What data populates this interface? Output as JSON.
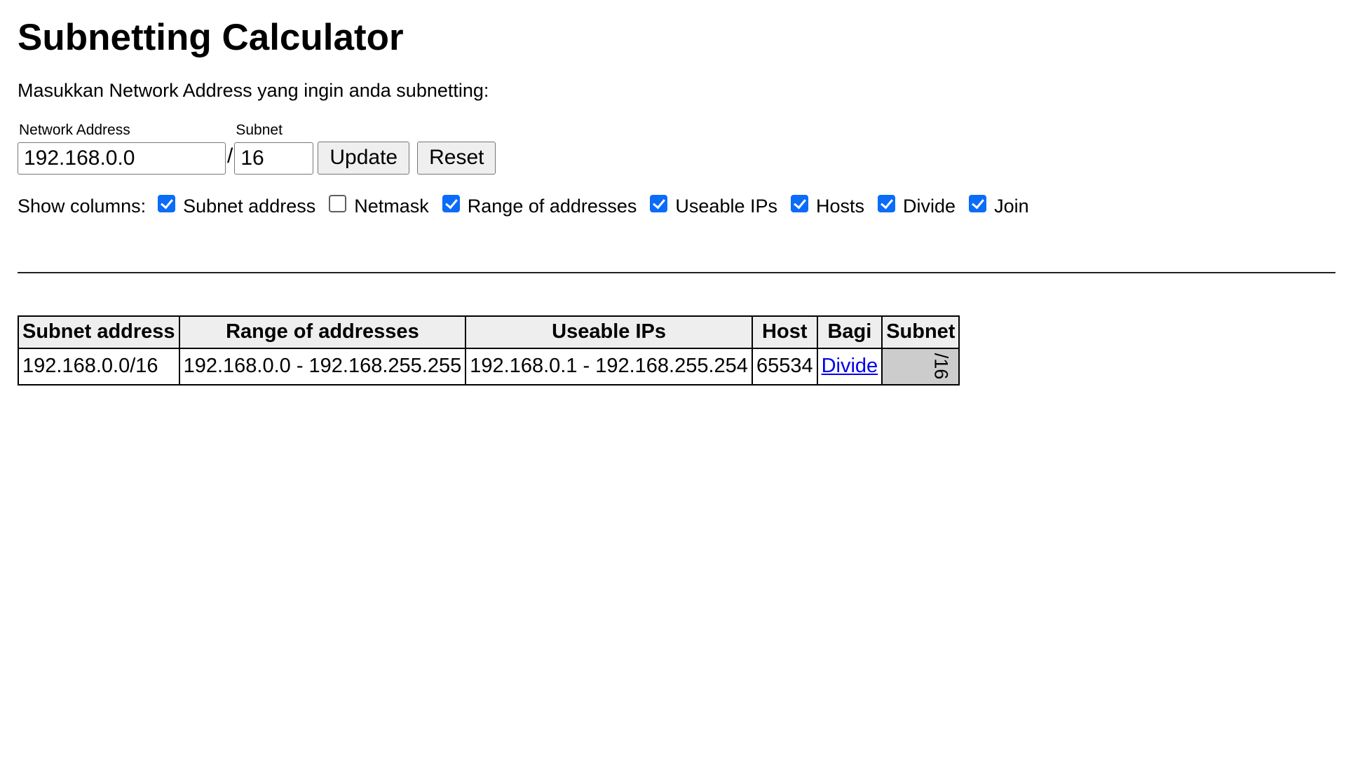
{
  "page": {
    "title": "Subnetting Calculator",
    "instruction": "Masukkan Network Address yang ingin anda subnetting:"
  },
  "form": {
    "network_label": "Network Address",
    "network_value": "192.168.0.0",
    "subnet_label": "Subnet",
    "separator": "/",
    "subnet_value": "16",
    "update_label": "Update",
    "reset_label": "Reset"
  },
  "columns": {
    "label": "Show columns:",
    "options": [
      {
        "label": "Subnet address",
        "checked": true
      },
      {
        "label": "Netmask",
        "checked": false
      },
      {
        "label": "Range of addresses",
        "checked": true
      },
      {
        "label": "Useable IPs",
        "checked": true
      },
      {
        "label": "Hosts",
        "checked": true
      },
      {
        "label": "Divide",
        "checked": true
      },
      {
        "label": "Join",
        "checked": true
      }
    ]
  },
  "table": {
    "headers": [
      "Subnet address",
      "Range of addresses",
      "Useable IPs",
      "Host",
      "Bagi",
      "Subnet"
    ],
    "rows": [
      {
        "subnet_address": "192.168.0.0/16",
        "range": "192.168.0.0 - 192.168.255.255",
        "useable": "192.168.0.1 - 192.168.255.254",
        "hosts": "65534",
        "divide": "Divide",
        "subnet": "/16"
      }
    ]
  },
  "colors": {
    "checkbox_accent": "#0b6cf8",
    "link": "#0000ee",
    "header_bg": "#eeeeee",
    "subnet_cell_bg": "#cccccc"
  }
}
